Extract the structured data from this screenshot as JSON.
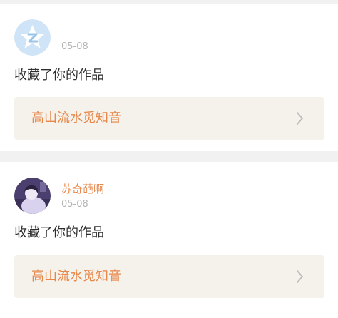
{
  "colors": {
    "page_background": "#f1f1f1",
    "card_background": "#ffffff",
    "accent": "#e8874a",
    "work_link_background": "#f4f2ea",
    "chevron": "#bdbdbd",
    "avatar_placeholder_background": "#cfe4f6"
  },
  "notifications": [
    {
      "avatar_icon": "default-avatar-icon",
      "username": "",
      "date": "05-08",
      "action": "收藏了你的作品",
      "work_title": "高山流水觅知音",
      "chevron_icon": "chevron-right-icon"
    },
    {
      "avatar_icon": "user-photo-avatar",
      "username": "苏奇葩啊",
      "date": "05-08",
      "action": "收藏了你的作品",
      "work_title": "高山流水觅知音",
      "chevron_icon": "chevron-right-icon"
    }
  ]
}
